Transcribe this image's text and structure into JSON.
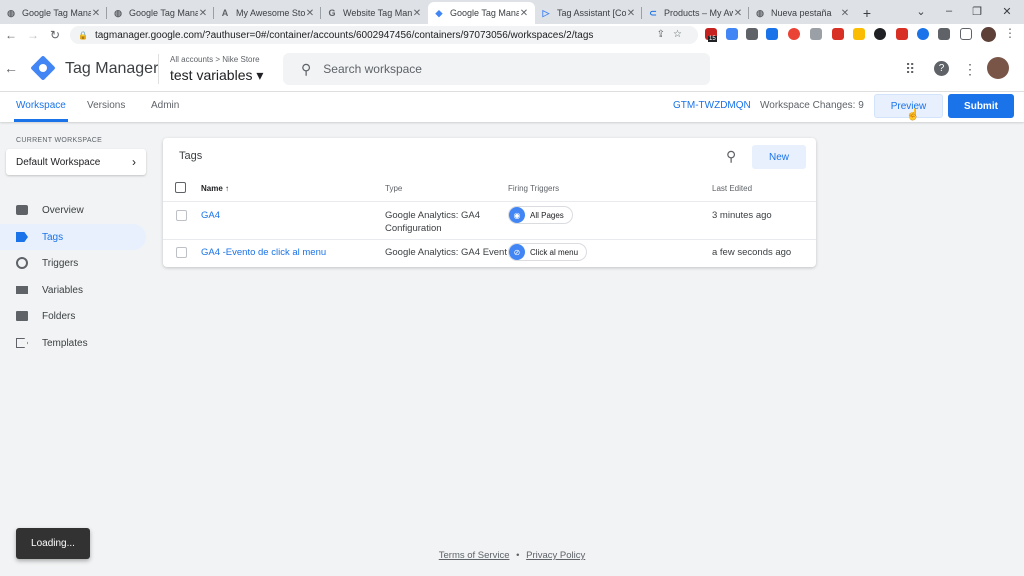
{
  "browser": {
    "tabs": [
      {
        "title": "Google Tag Mana",
        "favicon": "globe-icon",
        "active": false
      },
      {
        "title": "Google Tag Mana",
        "favicon": "globe-icon",
        "active": false
      },
      {
        "title": "My Awesome Sto",
        "favicon": "A",
        "active": false
      },
      {
        "title": "Website Tag Mana",
        "favicon": "G",
        "active": false
      },
      {
        "title": "Google Tag Mana",
        "favicon": "gtm-icon",
        "active": true
      },
      {
        "title": "Tag Assistant [Co",
        "favicon": "tag-icon",
        "active": false
      },
      {
        "title": "Products – My Aw",
        "favicon": "link-icon",
        "active": false
      },
      {
        "title": "Nueva pestaña",
        "favicon": "globe-icon",
        "active": false
      }
    ],
    "url": "tagmanager.google.com/?authuser=0#/container/accounts/6002947456/containers/97073056/workspaces/2/tags",
    "badge": "15"
  },
  "app": {
    "title": "Tag Manager",
    "breadcrumb": "All accounts  >  Nike Store",
    "container": "test variables ▾",
    "search_placeholder": "Search workspace"
  },
  "subnav": {
    "tabs": [
      "Workspace",
      "Versions",
      "Admin"
    ],
    "container_id": "GTM-TWZDMQN",
    "workspace_changes": "Workspace Changes: 9",
    "preview": "Preview",
    "submit": "Submit"
  },
  "sidebar": {
    "current_label": "CURRENT WORKSPACE",
    "current_value": "Default Workspace",
    "items": [
      "Overview",
      "Tags",
      "Triggers",
      "Variables",
      "Folders",
      "Templates"
    ],
    "active": "Tags"
  },
  "tags_card": {
    "title": "Tags",
    "new_button": "New",
    "columns": [
      "Name ↑",
      "Type",
      "Firing Triggers",
      "Last Edited"
    ],
    "rows": [
      {
        "name": "GA4",
        "type_line1": "Google Analytics: GA4",
        "type_line2": "Configuration",
        "trigger": "All Pages",
        "trigger_color": "#4285f4",
        "edited": "3 minutes ago"
      },
      {
        "name": "GA4 -Evento de click al menu",
        "type_line1": "Google Analytics: GA4 Event",
        "type_line2": "",
        "trigger": "Click al menu",
        "trigger_color": "#4285f4",
        "edited": "a few seconds ago"
      }
    ]
  },
  "footer": {
    "terms": "Terms of Service",
    "sep": "•",
    "privacy": "Privacy Policy"
  },
  "toast": "Loading..."
}
